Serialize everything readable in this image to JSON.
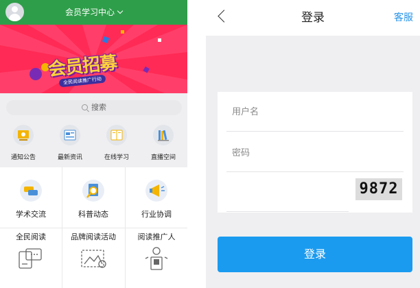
{
  "left_screen": {
    "header": {
      "title": "会员学习中心"
    },
    "banner": {
      "headline": "会员招募",
      "subtitle": "全民阅读推广行动",
      "dot_count": 2,
      "active_dot": 1
    },
    "search": {
      "placeholder": "搜索"
    },
    "quick_nav": [
      {
        "label": "通知公告",
        "icon": "notice-icon",
        "color": "#f4b400"
      },
      {
        "label": "最新资讯",
        "icon": "news-icon",
        "color": "#4a90d9"
      },
      {
        "label": "在线学习",
        "icon": "book-icon",
        "color": "#f4b400"
      },
      {
        "label": "直播空间",
        "icon": "books-shelf-icon",
        "color": "#4a90d9"
      }
    ],
    "modules_row1": [
      {
        "label": "学术交流",
        "icon": "academic-exchange-icon"
      },
      {
        "label": "科普动态",
        "icon": "science-search-icon"
      },
      {
        "label": "行业协调",
        "icon": "megaphone-icon"
      }
    ],
    "modules_row2": [
      {
        "label": "全民阅读",
        "icon": "reading-device-icon"
      },
      {
        "label": "品牌阅读活动",
        "icon": "picture-frame-icon"
      },
      {
        "label": "阅读推广人",
        "icon": "speaker-person-icon"
      }
    ]
  },
  "right_screen": {
    "nav": {
      "title": "登录",
      "action": "客服"
    },
    "form": {
      "username_placeholder": "用户名",
      "password_placeholder": "密码",
      "captcha_code": "9872"
    },
    "login_button": "登录",
    "accent_color": "#1a9bf0"
  }
}
